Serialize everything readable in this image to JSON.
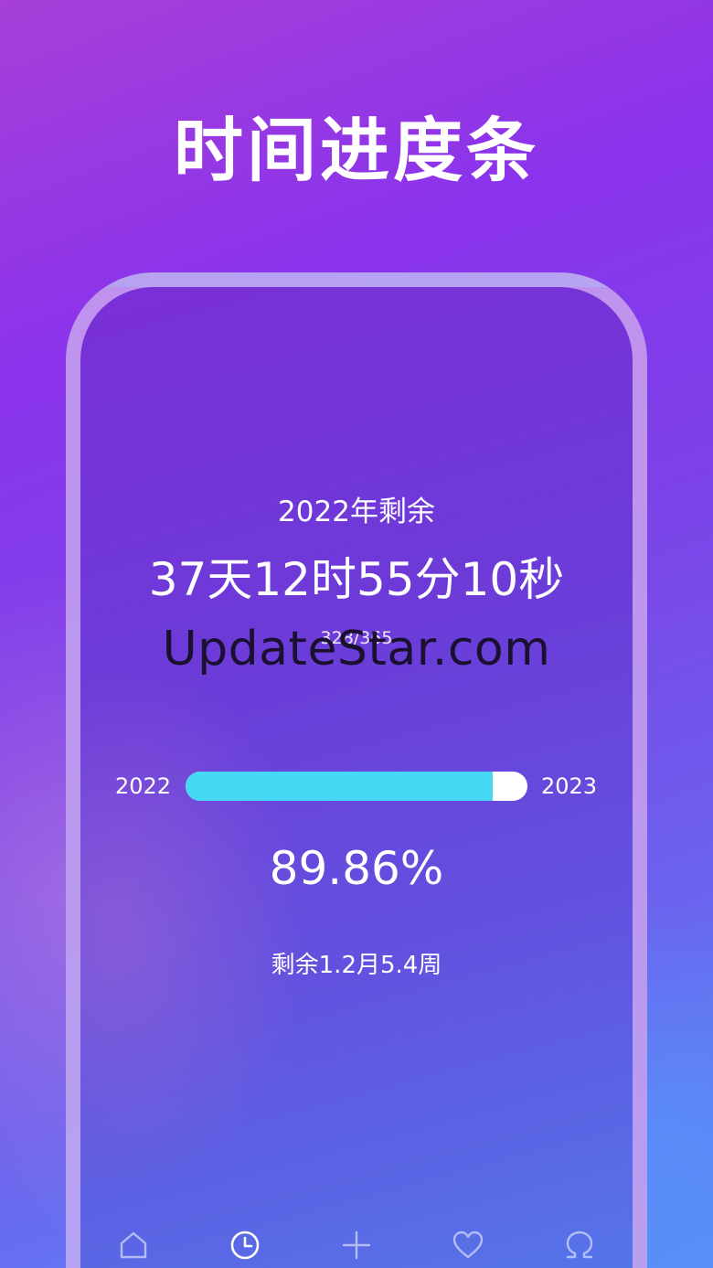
{
  "headline": "时间进度条",
  "screen": {
    "year_label": "2022年剩余",
    "countdown": "37天12时55分10秒",
    "days_fraction": "328/365",
    "watermark": "UpdateStar.com",
    "progress": {
      "start_label": "2022",
      "end_label": "2023",
      "fraction": 0.8986,
      "fill_color": "#46d8f5",
      "track_color": "#ffffff"
    },
    "percent_text": "89.86%",
    "remaining_text": "剩余1.2月5.4周"
  },
  "tabbar": {
    "items": [
      {
        "icon": "home-icon",
        "active": false
      },
      {
        "icon": "clock-icon",
        "active": true
      },
      {
        "icon": "plus-icon",
        "active": false
      },
      {
        "icon": "heart-icon",
        "active": false
      },
      {
        "icon": "omega-icon",
        "active": false
      }
    ]
  },
  "colors": {
    "bg_start": "#a73fd8",
    "bg_end": "#5a8cf6",
    "text": "#ffffff"
  }
}
